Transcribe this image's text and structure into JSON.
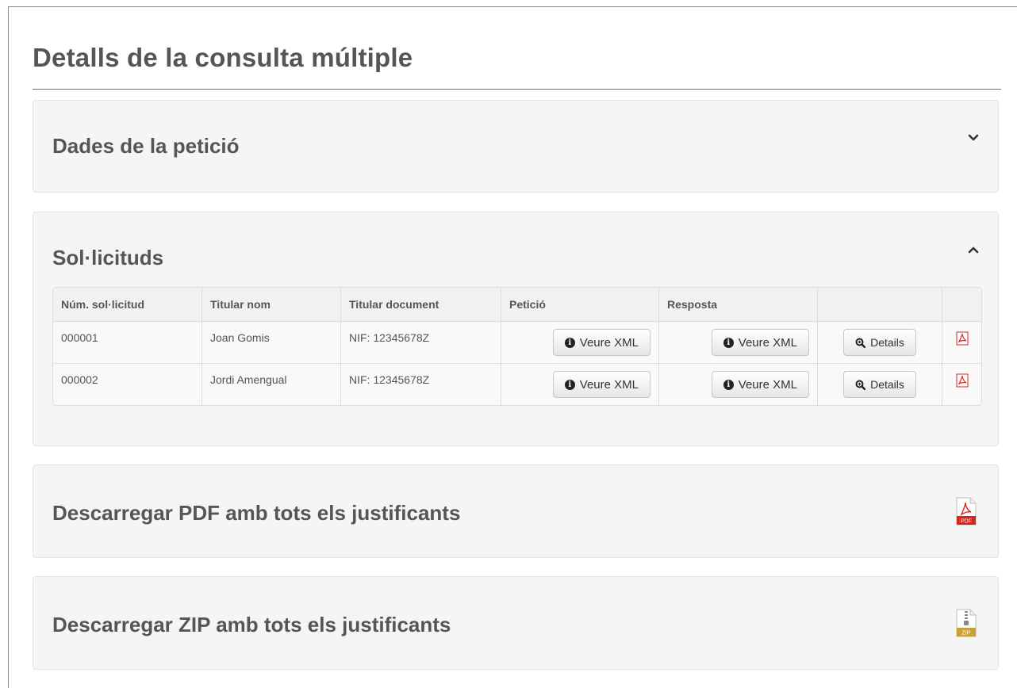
{
  "page": {
    "title": "Detalls de la consulta múltiple"
  },
  "panels": {
    "dades": {
      "heading": "Dades de la petició",
      "toggle_icon": "chevron-down-icon"
    },
    "sollicituds": {
      "heading": "Sol·licituds",
      "toggle_icon": "chevron-up-icon",
      "table": {
        "headers": [
          "Núm. sol·licitud",
          "Titular nom",
          "Titular document",
          "Petició",
          "Resposta",
          "",
          ""
        ],
        "rows": [
          {
            "num": "000001",
            "nom": "Joan Gomis",
            "document": "NIF: 12345678Z",
            "peticio_btn": "Veure XML",
            "resposta_btn": "Veure XML",
            "details_btn": "Details"
          },
          {
            "num": "000002",
            "nom": "Jordi Amengual",
            "document": "NIF: 12345678Z",
            "peticio_btn": "Veure XML",
            "resposta_btn": "Veure XML",
            "details_btn": "Details"
          }
        ]
      }
    },
    "pdf": {
      "heading": "Descarregar PDF amb tots els justificants",
      "icon_label": "PDF",
      "icon": "pdf-file-icon"
    },
    "zip": {
      "heading": "Descarregar ZIP amb tots els justificants",
      "icon_label": "ZIP",
      "icon": "zip-file-icon"
    }
  },
  "colors": {
    "panel_bg": "#f5f5f5",
    "pdf_red": "#d9261c",
    "zip_gold": "#c9a13a",
    "text": "#555555"
  }
}
